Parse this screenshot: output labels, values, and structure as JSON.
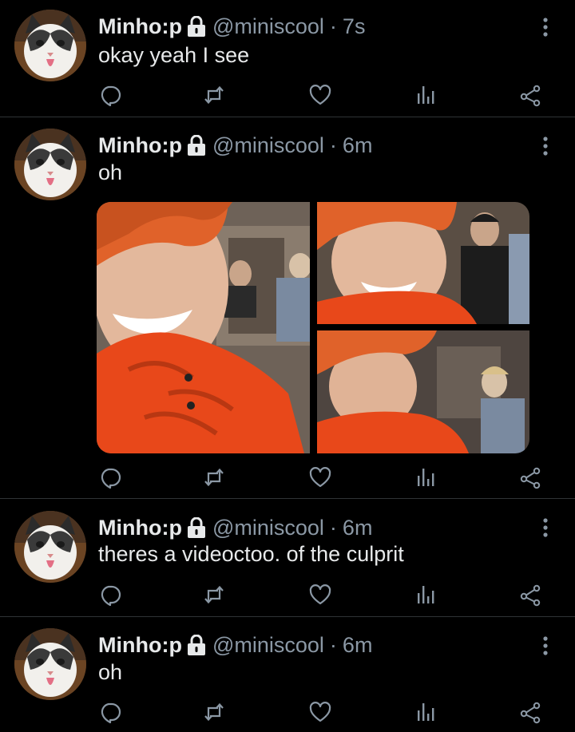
{
  "colors": {
    "background": "#000000",
    "text": "#e7e9ea",
    "muted": "#8b98a5",
    "divider": "#2f3336"
  },
  "icons": [
    "lock-icon",
    "more-icon",
    "reply-icon",
    "retweet-icon",
    "like-icon",
    "views-icon",
    "share-icon"
  ],
  "tweets": [
    {
      "name": "Minho:p",
      "handle": "@miniscool",
      "sep": "·",
      "time": "7s",
      "text": "okay yeah I see"
    },
    {
      "name": "Minho:p",
      "handle": "@miniscool",
      "sep": "·",
      "time": "6m",
      "text": "oh",
      "media_count": 3
    },
    {
      "name": "Minho:p",
      "handle": "@miniscool",
      "sep": "·",
      "time": "6m",
      "text": "theres a videoctoo. of the culprit"
    },
    {
      "name": "Minho:p",
      "handle": "@miniscool",
      "sep": "·",
      "time": "6m",
      "text": "oh"
    }
  ]
}
